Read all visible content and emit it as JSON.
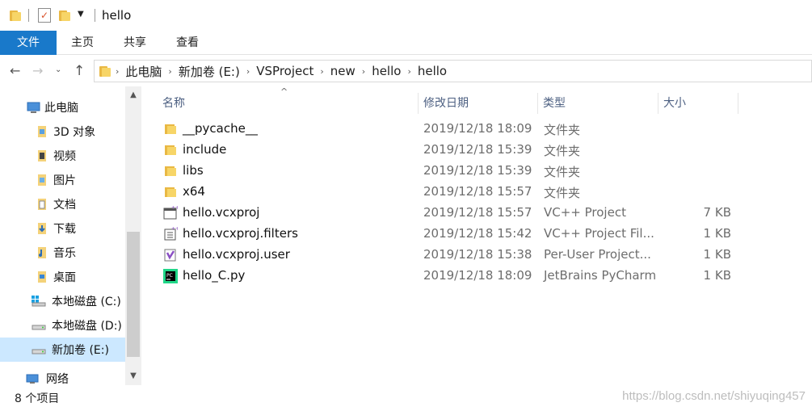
{
  "window": {
    "title": "hello"
  },
  "ribbon": {
    "tabs": [
      "文件",
      "主页",
      "共享",
      "查看"
    ]
  },
  "address": {
    "crumbs": [
      "此电脑",
      "新加卷 (E:)",
      "VSProject",
      "new",
      "hello",
      "hello"
    ]
  },
  "sidebar": {
    "items": [
      {
        "label": "此电脑",
        "icon": "computer-icon"
      },
      {
        "label": "3D 对象",
        "icon": "3d-objects-icon"
      },
      {
        "label": "视频",
        "icon": "video-icon"
      },
      {
        "label": "图片",
        "icon": "pictures-icon"
      },
      {
        "label": "文档",
        "icon": "documents-icon"
      },
      {
        "label": "下载",
        "icon": "downloads-icon"
      },
      {
        "label": "音乐",
        "icon": "music-icon"
      },
      {
        "label": "桌面",
        "icon": "desktop-icon"
      },
      {
        "label": "本地磁盘 (C:)",
        "icon": "system-drive-icon"
      },
      {
        "label": "本地磁盘 (D:)",
        "icon": "drive-icon"
      },
      {
        "label": "新加卷 (E:)",
        "icon": "drive-icon"
      },
      {
        "label": "网络",
        "icon": "network-icon"
      }
    ],
    "selected": "新加卷 (E:)"
  },
  "columns": {
    "name": "名称",
    "date": "修改日期",
    "type": "类型",
    "size": "大小"
  },
  "files": [
    {
      "name": "__pycache__",
      "date": "2019/12/18 18:09",
      "type": "文件夹",
      "size": "",
      "icon": "folder-icon"
    },
    {
      "name": "include",
      "date": "2019/12/18 15:39",
      "type": "文件夹",
      "size": "",
      "icon": "folder-icon"
    },
    {
      "name": "libs",
      "date": "2019/12/18 15:39",
      "type": "文件夹",
      "size": "",
      "icon": "folder-icon"
    },
    {
      "name": "x64",
      "date": "2019/12/18 15:57",
      "type": "文件夹",
      "size": "",
      "icon": "folder-icon"
    },
    {
      "name": "hello.vcxproj",
      "date": "2019/12/18 15:57",
      "type": "VC++ Project",
      "size": "7 KB",
      "icon": "vcxproj-icon"
    },
    {
      "name": "hello.vcxproj.filters",
      "date": "2019/12/18 15:42",
      "type": "VC++ Project Fil...",
      "size": "1 KB",
      "icon": "vcxproj-filters-icon"
    },
    {
      "name": "hello.vcxproj.user",
      "date": "2019/12/18 15:38",
      "type": "Per-User Project...",
      "size": "1 KB",
      "icon": "visual-studio-icon"
    },
    {
      "name": "hello_C.py",
      "date": "2019/12/18 18:09",
      "type": "JetBrains PyCharm",
      "size": "1 KB",
      "icon": "pycharm-icon"
    }
  ],
  "status": {
    "count": "8 个项目"
  },
  "watermark": "https://blog.csdn.net/shiyuqing457",
  "colors": {
    "accent": "#1979ca",
    "selection": "#cce8ff",
    "folder": "#f7d567"
  }
}
